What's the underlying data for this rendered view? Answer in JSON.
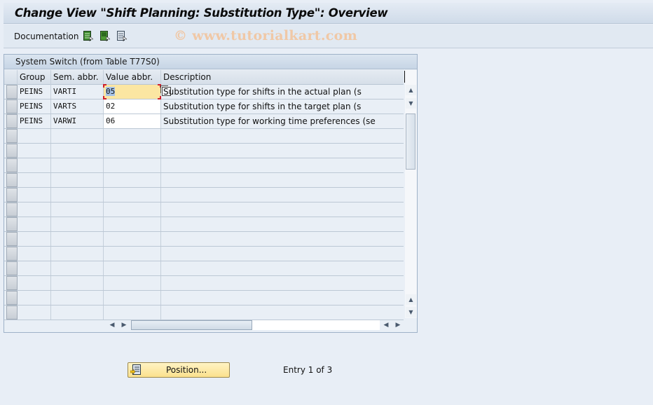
{
  "window": {
    "title": "Change View \"Shift Planning: Substitution Type\": Overview"
  },
  "toolbar": {
    "documentation_label": "Documentation",
    "icons": [
      "select-all-icon",
      "select-block-icon",
      "deselect-all-icon"
    ],
    "watermark": "© www.tutorialkart.com"
  },
  "panel": {
    "title": "System Switch (from Table T77S0)",
    "columns": [
      "Group",
      "Sem. abbr.",
      "Value abbr.",
      "Description"
    ],
    "rows": [
      {
        "group": "PEINS",
        "sem": "VARTI",
        "value": "05",
        "desc": "Substitution type for shifts in the actual plan (s"
      },
      {
        "group": "PEINS",
        "sem": "VARTS",
        "value": "02",
        "desc": "Substitution type for shifts in the target plan (s"
      },
      {
        "group": "PEINS",
        "sem": "VARWI",
        "value": "06",
        "desc": "Substitution type for working time preferences (se"
      }
    ],
    "visible_row_count": 16
  },
  "footer": {
    "position_button": "Position...",
    "entry_text": "Entry 1 of 3"
  },
  "colors": {
    "focus_cell": "#fbe6a2",
    "button_yellow": "#fbe18d",
    "background": "#e8eef6"
  }
}
